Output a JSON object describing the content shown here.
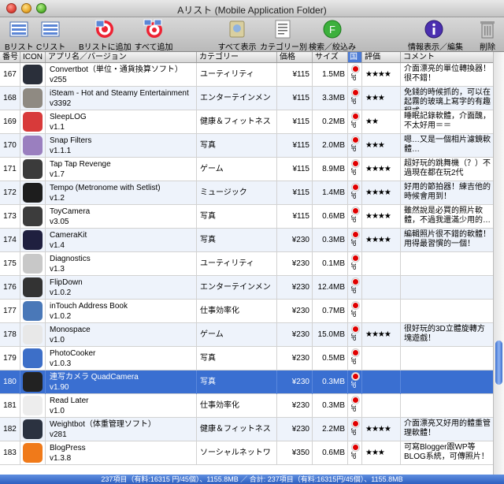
{
  "window": {
    "title": "Aリスト (Mobile Application Folder)"
  },
  "toolbar": {
    "b_list": "Bリスト",
    "c_list": "Cリスト",
    "add_to_b": "Bリストに追加",
    "add_all": "すべて追加",
    "show_all": "すべて表示",
    "by_category": "カテゴリー別",
    "search_filter": "検索／絞込み",
    "info_edit": "情報表示／編集",
    "delete": "削除"
  },
  "columns": {
    "num": "番号",
    "icon": "ICON",
    "name": "アプリ名／バージョン",
    "category": "カテゴリー",
    "price": "価格",
    "size": "サイズ",
    "country": "国",
    "rating": "評価",
    "comment": "コメント"
  },
  "rows": [
    {
      "num": "167",
      "name": "Convertbot（単位・通貨換算ソフト）",
      "version": "v255",
      "category": "ユーティリティ",
      "price": "¥115",
      "size": "1.5MB",
      "country": "JP",
      "rating": "★★★★",
      "comment": "介面漂亮的單位轉換器！很不錯！",
      "icon_color": "#2a2f3a"
    },
    {
      "num": "168",
      "name": "iSteam - Hot and Steamy Entertainment",
      "version": "v3392",
      "category": "エンターテインメント",
      "price": "¥115",
      "size": "3.3MB",
      "country": "JP",
      "rating": "★★★",
      "comment": "免錢的時候抓的，可以在起霧的玻璃上寫字的有趣程式。",
      "icon_color": "#8f8a82"
    },
    {
      "num": "169",
      "name": "SleepLOG",
      "version": "v1.1",
      "category": "健康＆フィットネス",
      "price": "¥115",
      "size": "0.2MB",
      "country": "JP",
      "rating": "★★",
      "comment": "睡眠記錄軟體，介面醜，不太好用＝＝",
      "icon_color": "#d83a3a"
    },
    {
      "num": "170",
      "name": "Snap Filters",
      "version": "v1.1.1",
      "category": "写真",
      "price": "¥115",
      "size": "2.0MB",
      "country": "JP",
      "rating": "★★★",
      "comment": "嗯…又是一個相片濾鏡軟體…",
      "icon_color": "#9a7fbf"
    },
    {
      "num": "171",
      "name": "Tap Tap Revenge",
      "version": "v1.7",
      "category": "ゲーム",
      "price": "¥115",
      "size": "8.9MB",
      "country": "JP",
      "rating": "★★★★",
      "comment": "超好玩的跳舞機（？）不過現在都在玩2代",
      "icon_color": "#3b3b3b"
    },
    {
      "num": "172",
      "name": "Tempo (Metronome with Setlist)",
      "version": "v1.2",
      "category": "ミュージック",
      "price": "¥115",
      "size": "1.4MB",
      "country": "JP",
      "rating": "★★★★",
      "comment": "好用的節拍器！練吉他的時候會用到！",
      "icon_color": "#1d1d1d"
    },
    {
      "num": "173",
      "name": "ToyCamera",
      "version": "v3.05",
      "category": "写真",
      "price": "¥115",
      "size": "0.6MB",
      "country": "JP",
      "rating": "★★★★",
      "comment": "雖然說是必買的照片軟體，不過我還滿少用的…",
      "icon_color": "#3c3c3c"
    },
    {
      "num": "174",
      "name": "CameraKit",
      "version": "v1.4",
      "category": "写真",
      "price": "¥230",
      "size": "0.3MB",
      "country": "JP",
      "rating": "★★★★",
      "comment": "編輯照片很不錯的軟體！用得最習慣的一個！",
      "icon_color": "#1f1f3f"
    },
    {
      "num": "175",
      "name": "Diagnostics",
      "version": "v1.3",
      "category": "ユーティリティ",
      "price": "¥230",
      "size": "0.1MB",
      "country": "JP",
      "rating": "",
      "comment": "",
      "icon_color": "#c8c8c8"
    },
    {
      "num": "176",
      "name": "FlipDown",
      "version": "v1.0.2",
      "category": "エンターテインメント",
      "price": "¥230",
      "size": "12.4MB",
      "country": "JP",
      "rating": "",
      "comment": "",
      "icon_color": "#333333"
    },
    {
      "num": "177",
      "name": "inTouch Address Book",
      "version": "v1.0.2",
      "category": "仕事効率化",
      "price": "¥230",
      "size": "0.7MB",
      "country": "JP",
      "rating": "",
      "comment": "",
      "icon_color": "#4a78b8"
    },
    {
      "num": "178",
      "name": "Monospace",
      "version": "v1.0",
      "category": "ゲーム",
      "price": "¥230",
      "size": "15.0MB",
      "country": "JP",
      "rating": "★★★★",
      "comment": "很好玩的3D立體旋轉方塊遊戲！",
      "icon_color": "#e8e8e8"
    },
    {
      "num": "179",
      "name": "PhotoCooker",
      "version": "v1.0.3",
      "category": "写真",
      "price": "¥230",
      "size": "0.5MB",
      "country": "JP",
      "rating": "",
      "comment": "",
      "icon_color": "#3d6fc8"
    },
    {
      "num": "180",
      "name": "連写カメラ QuadCamera",
      "version": "v1.90",
      "category": "写真",
      "price": "¥230",
      "size": "0.3MB",
      "country": "JP",
      "rating": "",
      "comment": "",
      "icon_color": "#222222"
    },
    {
      "num": "181",
      "name": "Read Later",
      "version": "v1.0",
      "category": "仕事効率化",
      "price": "¥230",
      "size": "0.3MB",
      "country": "JP",
      "rating": "",
      "comment": "",
      "icon_color": "#ededed"
    },
    {
      "num": "182",
      "name": "Weightbot（体重管理ソフト）",
      "version": "v281",
      "category": "健康＆フィットネス",
      "price": "¥230",
      "size": "2.2MB",
      "country": "JP",
      "rating": "★★★★",
      "comment": "介面漂亮又好用的體重管理軟體！",
      "icon_color": "#2b3240"
    },
    {
      "num": "183",
      "name": "BlogPress",
      "version": "v1.3.8",
      "category": "ソーシャルネットワーク",
      "price": "¥350",
      "size": "0.6MB",
      "country": "JP",
      "rating": "★★★",
      "comment": "可寫Blogger跟WP等BLOG系統，可傳照片！",
      "icon_color": "#f07a1a"
    }
  ],
  "selected_row": "180",
  "status": "237項目（有料:16315 円/45個）、1155.8MB ／ 合計: 237項目（有料:16315円/45個）、1155.8MB"
}
